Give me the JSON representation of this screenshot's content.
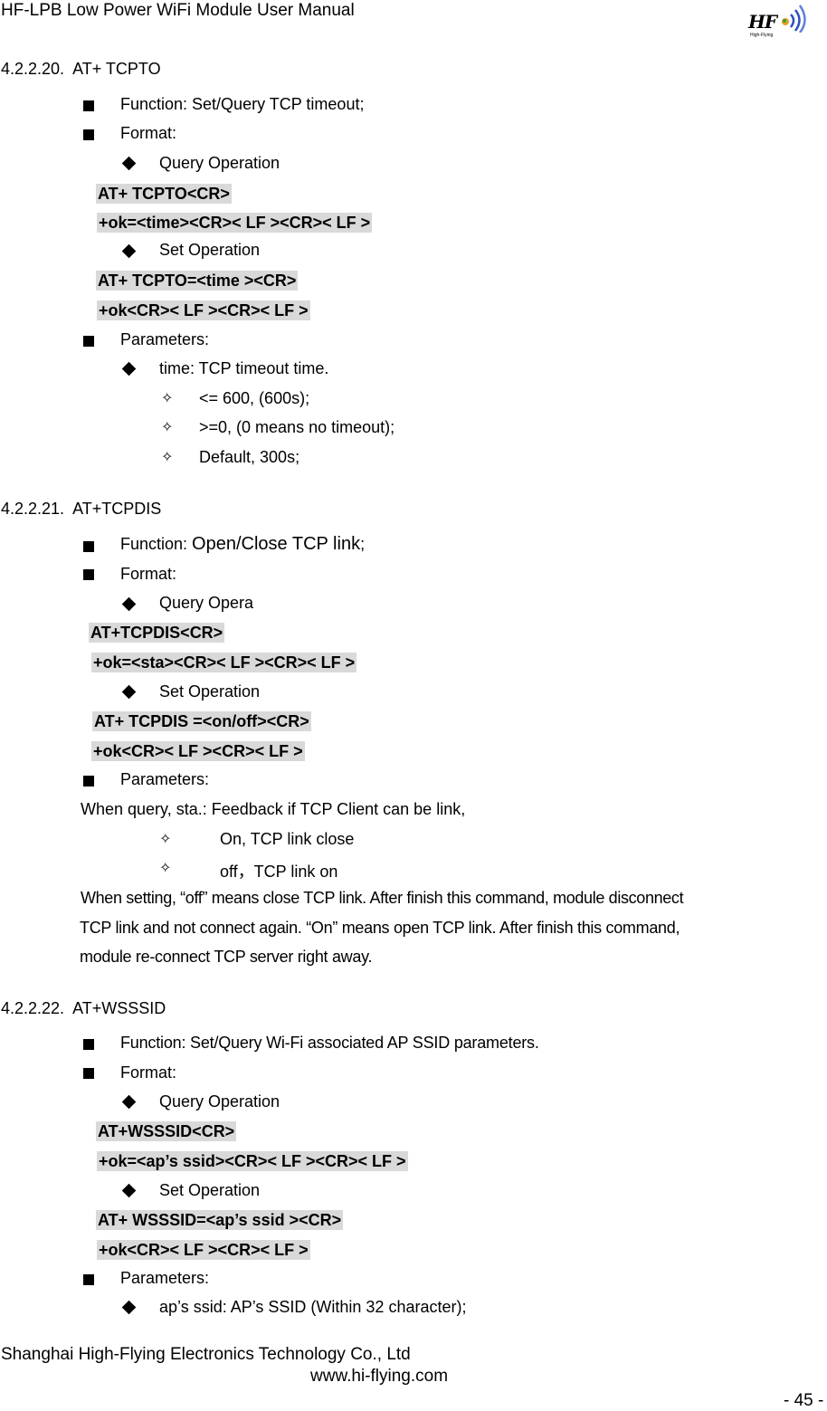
{
  "header": {
    "title": "HF-LPB Low Power WiFi Module User Manual",
    "logo": {
      "icon": "hf-logo-icon",
      "text": "HF",
      "subtext": "High-Flying"
    }
  },
  "sections": [
    {
      "number": "4.2.2.20.",
      "title": "AT+ TCPTO",
      "function": "Function: Set/Query TCP timeout;",
      "format_label": "Format:",
      "query_label": "Query Operation",
      "query_cmd": "AT+ TCPTO<CR>",
      "query_resp": "+ok=<time><CR>< LF ><CR>< LF >",
      "set_label": "Set Operation",
      "set_cmd": "AT+ TCPTO=<time ><CR>",
      "set_resp": "+ok<CR>< LF ><CR>< LF >",
      "params_label": "Parameters:",
      "param": "time: TCP timeout time.",
      "param_items": [
        "<= 600, (600s);",
        ">=0, (0 means no timeout);",
        "Default, 300s;"
      ]
    },
    {
      "number": "4.2.2.21.",
      "title": "AT+TCPDIS",
      "function_prefix": "Function: ",
      "function_main": "Open/Close TCP link",
      "function_suffix": ";",
      "format_label": "Format:",
      "query_label": "Query Opera",
      "query_cmd": "AT+TCPDIS<CR>",
      "query_resp": "+ok=<sta><CR>< LF ><CR>< LF >",
      "set_label": "Set Operation",
      "set_cmd": " AT+ TCPDIS =<on/off><CR>",
      "set_resp": "+ok<CR>< LF ><CR>< LF >",
      "params_label": "Parameters:",
      "query_note": "When query, sta.: Feedback if TCP Client can be link,",
      "param_items": [
        "On,  TCP link close",
        "off，TCP link on"
      ],
      "set_note_lines": [
        "When setting, “off” means close TCP link. After finish this command, module disconnect",
        "TCP link and not connect again. “On” means open TCP link. After finish this command,",
        "module re-connect TCP server right away."
      ]
    },
    {
      "number": "4.2.2.22.",
      "title": "AT+WSSSID",
      "function": "Function: Set/Query Wi-Fi associated AP SSID parameters.",
      "format_label": "Format:",
      "query_label": "Query Operation",
      "query_cmd": "AT+WSSSID<CR>",
      "query_resp": "+ok=<ap’s ssid><CR>< LF ><CR>< LF >",
      "set_label": "Set Operation",
      "set_cmd": "AT+ WSSSID=<ap’s ssid ><CR>",
      "set_resp": "+ok<CR>< LF ><CR>< LF >",
      "params_label": "Parameters:",
      "param": "ap’s ssid: AP’s SSID (Within 32 character);"
    }
  ],
  "footer": {
    "company": "Shanghai High-Flying Electronics Technology Co., Ltd",
    "website": "www.hi-flying.com",
    "page": "- 45 -"
  }
}
